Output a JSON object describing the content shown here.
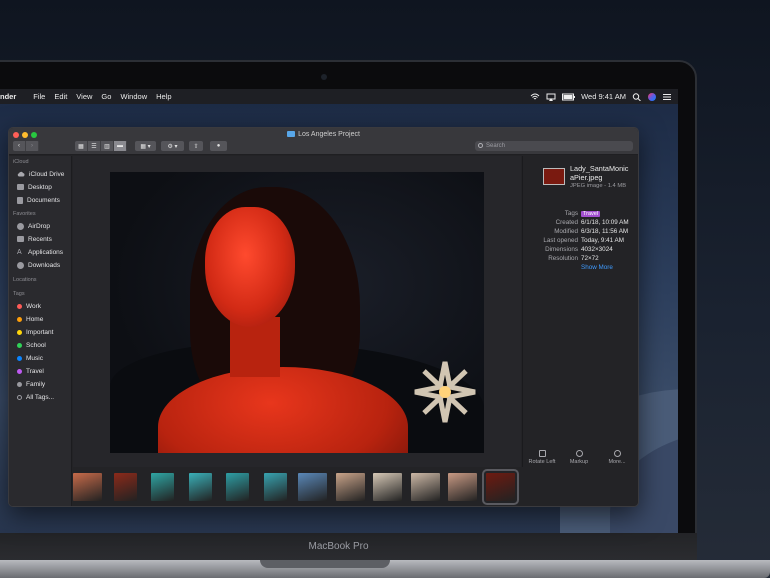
{
  "menubar": {
    "app_name": "nder",
    "items": [
      "File",
      "Edit",
      "View",
      "Go",
      "Window",
      "Help"
    ],
    "clock": "Wed 9:41 AM"
  },
  "window": {
    "title": "Los Angeles Project",
    "search_placeholder": "Search"
  },
  "sidebar": {
    "sections": [
      {
        "heading": "iCloud",
        "items": [
          {
            "label": "iCloud Drive",
            "icon": "cloud-icon"
          },
          {
            "label": "Desktop",
            "icon": "desktop-icon"
          },
          {
            "label": "Documents",
            "icon": "document-icon"
          }
        ]
      },
      {
        "heading": "Favorites",
        "items": [
          {
            "label": "AirDrop",
            "icon": "airdrop-icon"
          },
          {
            "label": "Recents",
            "icon": "clock-icon"
          },
          {
            "label": "Applications",
            "icon": "applications-icon"
          },
          {
            "label": "Downloads",
            "icon": "download-icon"
          }
        ]
      },
      {
        "heading": "Locations",
        "items": []
      },
      {
        "heading": "Tags",
        "items": [
          {
            "label": "Work",
            "color": "#ff5b57"
          },
          {
            "label": "Home",
            "color": "#ff9f0a"
          },
          {
            "label": "Important",
            "color": "#ffd60a"
          },
          {
            "label": "School",
            "color": "#30d158"
          },
          {
            "label": "Music",
            "color": "#0a84ff"
          },
          {
            "label": "Travel",
            "color": "#bf5af2"
          },
          {
            "label": "Family",
            "color": "#9a9aa0"
          },
          {
            "label": "All Tags...",
            "icon": "tags-icon"
          }
        ]
      }
    ]
  },
  "inspector": {
    "file_name": "Lady_SantaMonicaPier.jpeg",
    "file_name_line1": "Lady_SantaMonic",
    "file_name_line2": "aPier.jpeg",
    "file_kind": "JPEG image - 1.4 MB",
    "metadata": [
      {
        "key": "Tags",
        "value": "Travel",
        "tag_color": "#a24fd0"
      },
      {
        "key": "Created",
        "value": "6/1/18, 10:09 AM"
      },
      {
        "key": "Modified",
        "value": "6/3/18, 11:56 AM"
      },
      {
        "key": "Last opened",
        "value": "Today, 9:41 AM"
      },
      {
        "key": "Dimensions",
        "value": "4032×3024"
      },
      {
        "key": "Resolution",
        "value": "72×72"
      }
    ],
    "show_more": "Show More",
    "actions": [
      "Rotate Left",
      "Markup",
      "More..."
    ]
  },
  "filmstrip": {
    "thumbnail_count": 12,
    "selected_index": 11,
    "thumbnail_colors": [
      "#c76b4a",
      "#8c2a1a",
      "#2fa6a4",
      "#3ab0b8",
      "#2e9ea4",
      "#38a3b0",
      "#5a88b8",
      "#c9a48a",
      "#d6c8b6",
      "#ccb8a6",
      "#c89a84",
      "#6e1a10"
    ]
  },
  "laptop": {
    "label": "MacBook Pro"
  }
}
